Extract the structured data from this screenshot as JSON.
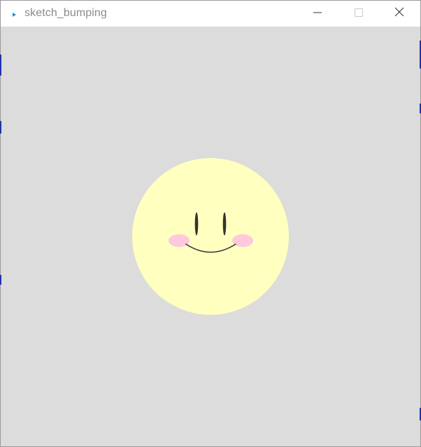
{
  "window": {
    "title": "sketch_bumping",
    "background_color": "#DCDCDC"
  },
  "titlebar": {
    "app_icon": "play-arrow-icon",
    "minimize_icon": "minimize-icon",
    "maximize_icon": "maximize-icon",
    "close_icon": "close-icon"
  },
  "sketch": {
    "face_color": "#FFFFC0",
    "cheek_color": "#FFC8DC",
    "feature_color": "#333333"
  }
}
